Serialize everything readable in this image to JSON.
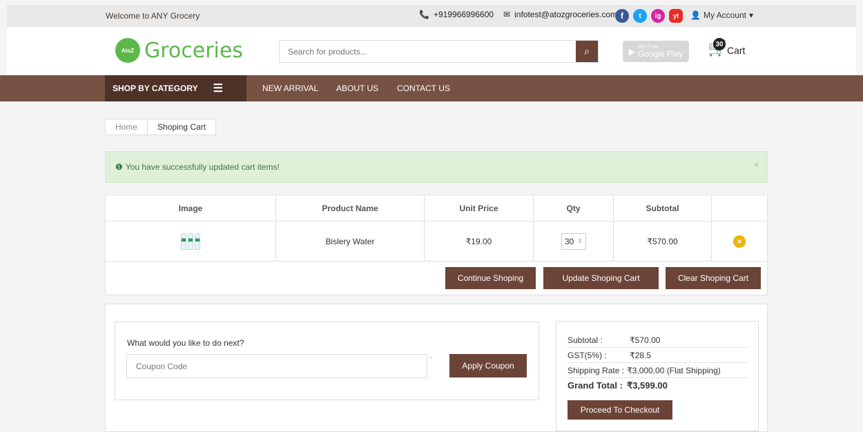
{
  "topbar": {
    "welcome": "Welcome to ANY Grocery",
    "phone": "+919966996600",
    "email": "infotest@atozgroceries.com",
    "social": [
      "f",
      "t",
      "ig",
      "yt"
    ],
    "account_label": "My Account"
  },
  "header": {
    "logo_badge": "AtoZ",
    "logo_text": "Groceries",
    "search_placeholder": "Search for products...",
    "gplay_small": "GET IT ON",
    "gplay_label": "Google Play",
    "cart_count": "30",
    "cart_label": "Cart"
  },
  "nav": {
    "category_label": "SHOP BY CATEGORY",
    "links": [
      "NEW ARRIVAL",
      "ABOUT US",
      "CONTACT US"
    ]
  },
  "breadcrumb": {
    "home": "Home",
    "current": "Shoping Cart"
  },
  "alert": {
    "message": "You have successfully updated cart items!",
    "close": "×"
  },
  "cart_table": {
    "headers": [
      "Image",
      "Product Name",
      "Unit Price",
      "Qty",
      "Subtotal"
    ],
    "rows": [
      {
        "product": "Bislery Water",
        "unit_price": "₹19.00",
        "qty": "30",
        "subtotal": "₹570.00"
      }
    ]
  },
  "buttons": {
    "continue": "Continue Shoping",
    "update": "Update Shoping Cart",
    "clear": "Clear Shoping Cart",
    "apply_coupon": "Apply Coupon",
    "checkout": "Proceed To Checkout"
  },
  "coupon": {
    "question": "What would you like to do next?",
    "placeholder": "Coupon Code",
    "tick": "`"
  },
  "totals": {
    "subtotal_label": "Subtotal :",
    "subtotal_value": "₹570.00",
    "gst_label": "GST(5%) :",
    "gst_value": "₹28.5",
    "shipping_label": "Shipping Rate :",
    "shipping_value": "₹3,000.00 (Flat Shipping)",
    "grand_label": "Grand Total :",
    "grand_value": "₹3,599.00"
  },
  "colors": {
    "brand_brown": "#6b4437",
    "nav_brown": "#775143",
    "logo_green": "#5db84a",
    "alert_bg": "#dff0d8"
  }
}
